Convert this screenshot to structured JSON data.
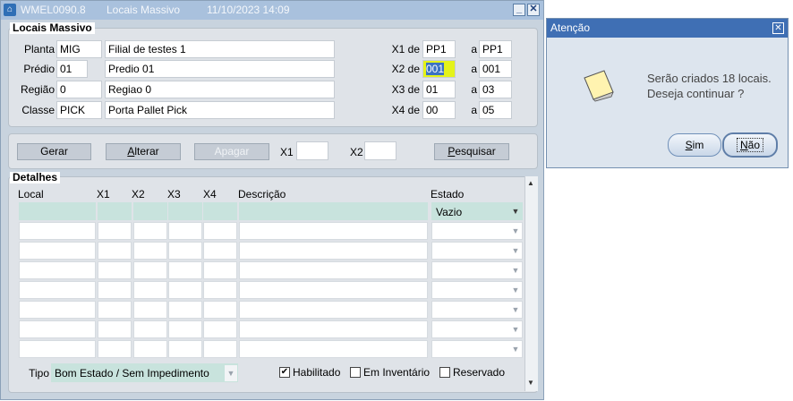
{
  "window": {
    "title_code": "WMEL0090.8",
    "title_name": "Locais Massivo",
    "title_datetime": "11/10/2023 14:09"
  },
  "locais": {
    "section_title": "Locais Massivo",
    "planta": {
      "label": "Planta",
      "code": "MIG",
      "desc": "Filial de testes 1"
    },
    "predio": {
      "label": "Prédio",
      "code": "01",
      "desc": "Predio 01"
    },
    "regiao": {
      "label": "Região",
      "code": "0",
      "desc": "Regiao 0"
    },
    "classe": {
      "label": "Classe",
      "code": "PICK",
      "desc": "Porta Pallet Pick"
    },
    "ranges": [
      {
        "label_de": "X1 de",
        "de": "PP1",
        "label_a": "a",
        "a": "PP1"
      },
      {
        "label_de": "X2 de",
        "de": "001",
        "label_a": "a",
        "a": "001"
      },
      {
        "label_de": "X3 de",
        "de": "01",
        "label_a": "a",
        "a": "03"
      },
      {
        "label_de": "X4 de",
        "de": "00",
        "label_a": "a",
        "a": "05"
      }
    ]
  },
  "toolbar": {
    "gerar": "Gerar",
    "alterar_u": "A",
    "alterar_rest": "lterar",
    "apagar": "Apagar",
    "x1_label": "X1",
    "x1_value": "",
    "x2_label": "X2",
    "x2_value": "",
    "pesquisar_u": "P",
    "pesquisar_rest": "esquisar"
  },
  "detalhes": {
    "section_title": "Detalhes",
    "columns": [
      "Local",
      "X1",
      "X2",
      "X3",
      "X4",
      "Descrição",
      "Estado"
    ],
    "first_row_estado": "Vazio",
    "tipo_label": "Tipo",
    "tipo_value": "Bom Estado / Sem Impedimento",
    "habilitado_label": "Habilitado",
    "habilitado_checked": true,
    "inventario_label": "Em Inventário",
    "inventario_checked": false,
    "reservado_label": "Reservado",
    "reservado_checked": false
  },
  "dialog": {
    "title": "Atenção",
    "message_line1": "Serão criados 18 locais.",
    "message_line2": "Deseja continuar ?",
    "sim_u": "S",
    "sim_rest": "im",
    "nao_u": "N",
    "nao_rest": "ão"
  },
  "colors": {
    "titlebar_inactive": "#a9c1dd",
    "dialog_titlebar": "#3f6fb4",
    "row_highlight": "#c8e3dd",
    "field_highlight": "#e4f31a"
  }
}
